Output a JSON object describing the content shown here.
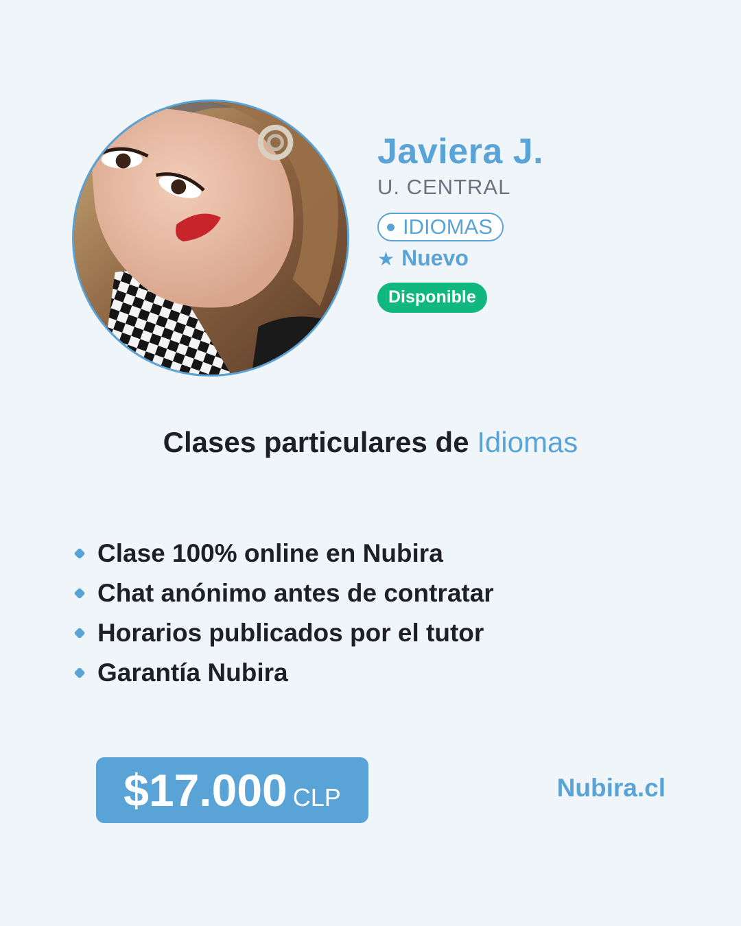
{
  "profile": {
    "name": "Javiera J.",
    "university": "U. CENTRAL",
    "subject_tag": "IDIOMAS",
    "new_label": "Nuevo",
    "status": "Disponible",
    "avatar_icon": "profile-photo"
  },
  "headline": {
    "prefix": "Clases particulares de",
    "subject": "Idiomas"
  },
  "features": [
    "Clase 100% online en Nubira",
    "Chat anónimo antes de contratar",
    "Horarios publicados por el tutor",
    "Garantía Nubira"
  ],
  "price": {
    "amount": "$17.000",
    "currency": "CLP"
  },
  "brand": "Nubira.cl",
  "colors": {
    "background": "#f0f5fa",
    "accent": "#5aa3d6",
    "status_green": "#10b77e",
    "text_dark": "#1f2025",
    "text_muted": "#6b7280"
  }
}
